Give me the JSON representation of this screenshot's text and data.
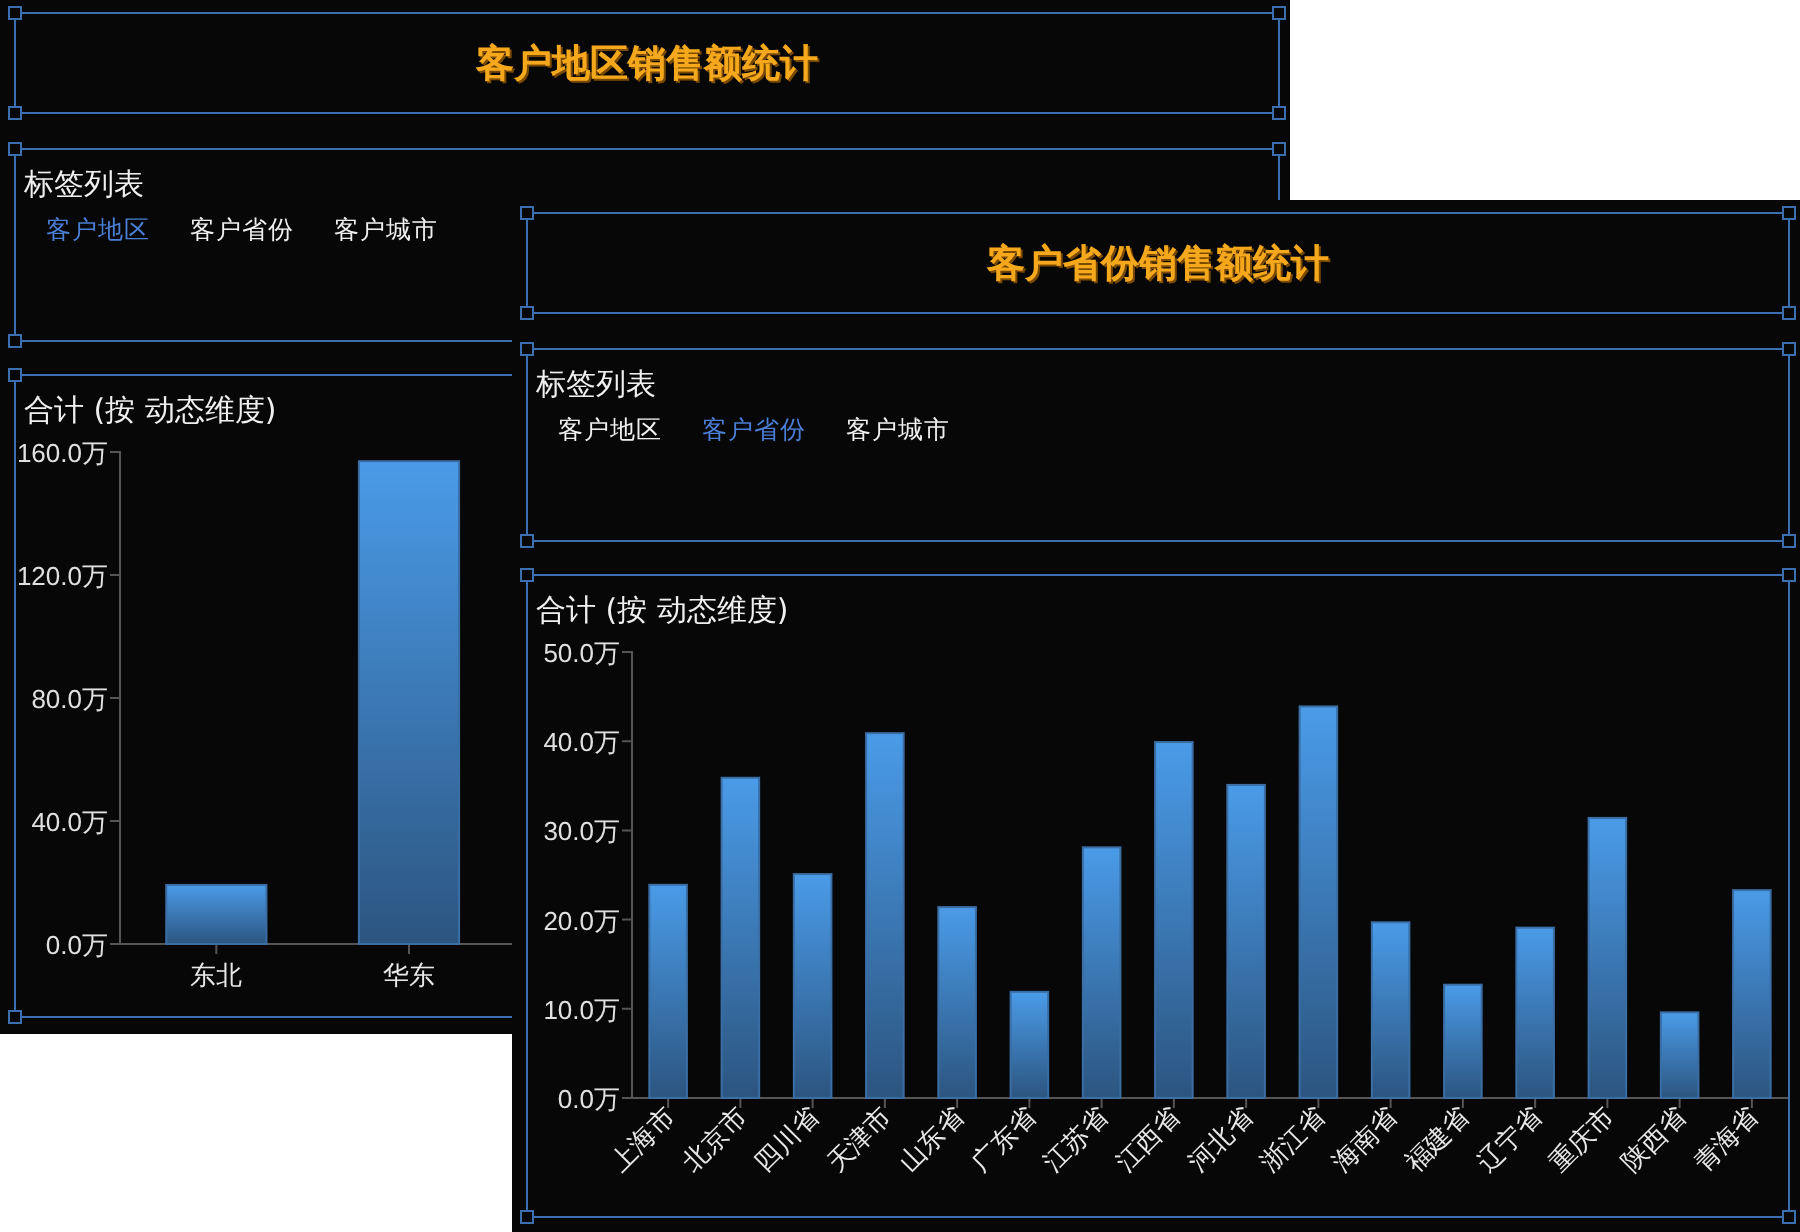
{
  "windows": [
    {
      "title": "客户地区销售额统计",
      "tag_panel": {
        "heading": "标签列表",
        "tags": [
          {
            "label": "客户地区",
            "selected": true
          },
          {
            "label": "客户省份",
            "selected": false
          },
          {
            "label": "客户城市",
            "selected": false
          }
        ]
      },
      "chart": {
        "title": "合计 (按 动态维度)",
        "chart_data": {
          "type": "bar",
          "categories": [
            "东北",
            "华东"
          ],
          "values": [
            19.2,
            157
          ],
          "ylim": [
            0,
            160
          ],
          "yticks": [
            {
              "value": 0,
              "label": "0.0万"
            },
            {
              "value": 40,
              "label": "40.0万"
            },
            {
              "value": 80,
              "label": "80.0万"
            },
            {
              "value": 120,
              "label": "120.0万"
            },
            {
              "value": 160,
              "label": "160.0万"
            }
          ]
        }
      }
    },
    {
      "title": "客户省份销售额统计",
      "tag_panel": {
        "heading": "标签列表",
        "tags": [
          {
            "label": "客户地区",
            "selected": false
          },
          {
            "label": "客户省份",
            "selected": true
          },
          {
            "label": "客户城市",
            "selected": false
          }
        ]
      },
      "chart": {
        "title": "合计 (按 动态维度)",
        "chart_data": {
          "type": "bar",
          "categories": [
            "上海市",
            "北京市",
            "四川省",
            "天津市",
            "山东省",
            "广东省",
            "江苏省",
            "江西省",
            "河北省",
            "浙江省",
            "海南省",
            "福建省",
            "辽宁省",
            "重庆市",
            "陕西省",
            "青海省"
          ],
          "values": [
            23.9,
            35.9,
            25.1,
            40.9,
            21.4,
            11.9,
            28.1,
            39.9,
            35.1,
            43.9,
            19.7,
            12.7,
            19.1,
            31.4,
            9.6,
            23.3
          ],
          "ylim": [
            0,
            50
          ],
          "yticks": [
            {
              "value": 0,
              "label": "0.0万"
            },
            {
              "value": 10,
              "label": "10.0万"
            },
            {
              "value": 20,
              "label": "20.0万"
            },
            {
              "value": 30,
              "label": "30.0万"
            },
            {
              "value": 40,
              "label": "40.0万"
            },
            {
              "value": 50,
              "label": "50.0万"
            }
          ]
        }
      }
    }
  ]
}
